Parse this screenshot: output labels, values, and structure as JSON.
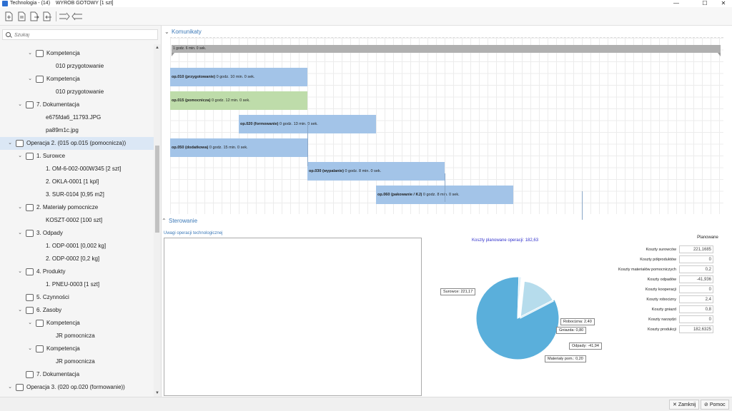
{
  "window": {
    "app_name": "Technologia - (14)",
    "doc_title": "WYRÓB GOTOWY [1 szt]",
    "minimize": "—",
    "maximize": "☐",
    "close": "✕"
  },
  "search": {
    "placeholder": "Szukaj"
  },
  "tree": [
    {
      "depth": 2,
      "chev": "⌄",
      "icon": "competence-icon",
      "label": "Kompetencja"
    },
    {
      "depth": 4,
      "chev": "",
      "icon": "",
      "label": "010 przygotowanie"
    },
    {
      "depth": 2,
      "chev": "⌄",
      "icon": "tool-icon",
      "label": "Kompetencja"
    },
    {
      "depth": 4,
      "chev": "",
      "icon": "",
      "label": "010 przygotowanie"
    },
    {
      "depth": 1,
      "chev": "⌄",
      "icon": "documents-icon",
      "label": "7. Dokumentacja"
    },
    {
      "depth": 3,
      "chev": "",
      "icon": "",
      "label": "e675fda6_11793.JPG"
    },
    {
      "depth": 3,
      "chev": "",
      "icon": "",
      "label": "pa89m1c.jpg"
    },
    {
      "depth": 0,
      "chev": "⌄",
      "icon": "operation-icon",
      "label": "Operacja 2. (015 op.015 (pomocnicza))",
      "selected": true
    },
    {
      "depth": 1,
      "chev": "⌄",
      "icon": "materials-icon",
      "label": "1. Surowce"
    },
    {
      "depth": 3,
      "chev": "",
      "icon": "",
      "label": "1. OM-6-002-000W345 [2 szt]"
    },
    {
      "depth": 3,
      "chev": "",
      "icon": "",
      "label": "2. OKLA-0001 [1 kpl]"
    },
    {
      "depth": 3,
      "chev": "",
      "icon": "",
      "label": "3. SUR-0104 [0,95 m2]"
    },
    {
      "depth": 1,
      "chev": "⌄",
      "icon": "aux-materials-icon",
      "label": "2. Materiały pomocnicze"
    },
    {
      "depth": 3,
      "chev": "",
      "icon": "",
      "label": "KOSZT-0002 [100 szt]"
    },
    {
      "depth": 1,
      "chev": "⌄",
      "icon": "waste-icon",
      "label": "3. Odpady"
    },
    {
      "depth": 3,
      "chev": "",
      "icon": "",
      "label": "1. ODP-0001 [0,002 kg]"
    },
    {
      "depth": 3,
      "chev": "",
      "icon": "",
      "label": "2. ODP-0002 [0,2 kg]"
    },
    {
      "depth": 1,
      "chev": "⌄",
      "icon": "products-icon",
      "label": "4. Produkty"
    },
    {
      "depth": 3,
      "chev": "",
      "icon": "",
      "label": "1. PNEU-0003 [1 szt]"
    },
    {
      "depth": 1,
      "chev": "",
      "icon": "activities-icon",
      "label": "5. Czynności"
    },
    {
      "depth": 1,
      "chev": "⌄",
      "icon": "resources-icon",
      "label": "6. Zasoby"
    },
    {
      "depth": 2,
      "chev": "⌄",
      "icon": "competence-icon",
      "label": "Kompetencja"
    },
    {
      "depth": 4,
      "chev": "",
      "icon": "",
      "label": "JR pomocnicza"
    },
    {
      "depth": 2,
      "chev": "⌄",
      "icon": "competence-icon",
      "label": "Kompetencja"
    },
    {
      "depth": 4,
      "chev": "",
      "icon": "",
      "label": "JR pomocnicza"
    },
    {
      "depth": 1,
      "chev": "",
      "icon": "documents-icon",
      "label": "7. Dokumentacja"
    },
    {
      "depth": 0,
      "chev": "⌄",
      "icon": "operation-icon",
      "label": "Operacja 3. (020 op.020 (formowanie))"
    }
  ],
  "komunikaty": {
    "title": "Komunikaty",
    "summary": "1 godz. 6 min. 0 sek.",
    "operations": [
      {
        "name": "op.010 (przygotowanie)",
        "time": "0 godz. 10 min. 0 sek.",
        "color": "#a3c4e8",
        "start": 0,
        "minutes": 10,
        "row": 0
      },
      {
        "name": "op.015 (pomocnicza)",
        "time": "0 godz. 12 min. 0 sek.",
        "color": "#bedcaa",
        "start": 0,
        "minutes": 12,
        "row": 1
      },
      {
        "name": "op.020 (formowanie)",
        "time": "0 godz. 13 min. 0 sek.",
        "color": "#a3c4e8",
        "start": 12,
        "minutes": 13,
        "row": 2
      },
      {
        "name": "op.050 (dodatkowa)",
        "time": "0 godz. 15 min. 0 sek.",
        "color": "#a3c4e8",
        "start": 0,
        "minutes": 15,
        "row": 3
      },
      {
        "name": "op.030 (wypalanie)",
        "time": "0 godz. 8 min. 0 sek.",
        "color": "#a3c4e8",
        "start": 24,
        "minutes": 8,
        "row": 4
      },
      {
        "name": "op.060 (pakowanie / KJ)",
        "time": "0 godz. 8 min. 0 sek.",
        "color": "#a3c4e8",
        "start": 36,
        "minutes": 8,
        "row": 5
      }
    ]
  },
  "sterowanie": {
    "title": "Sterowanie",
    "notes_label": "Uwagi operacji technologicznej",
    "notes_text": ""
  },
  "chart_data": {
    "type": "pie",
    "title": "Koszty planowane operacji: 182,63",
    "slices": [
      {
        "label": "Surowce: 221,17",
        "value": 221.17,
        "color": "#5aafdb"
      },
      {
        "label": "Robocizna: 2,40",
        "value": 2.4,
        "color": "#d8eef8"
      },
      {
        "label": "Gniazda: 0,80",
        "value": 0.8,
        "color": "#c8e6f2"
      },
      {
        "label": "Odpady: -41,94",
        "value": -41.94,
        "color": "#b6dcec"
      },
      {
        "label": "Materiały pom.: 0,20",
        "value": 0.2,
        "color": "#e8f4fa"
      }
    ]
  },
  "costs": {
    "column_header": "Planowane",
    "rows": [
      {
        "label": "Koszty surowców",
        "value": "221,1685"
      },
      {
        "label": "Koszty półproduktów",
        "value": "0"
      },
      {
        "label": "Koszty materiałów pomocniczych",
        "value": "0,2"
      },
      {
        "label": "Koszty odpadów",
        "value": "-41,936"
      },
      {
        "label": "Koszty kooperacji",
        "value": "0"
      },
      {
        "label": "Koszty robocizny",
        "value": "2,4"
      },
      {
        "label": "Koszty gniazd",
        "value": "0,8"
      },
      {
        "label": "Koszty narzędzi",
        "value": "0"
      },
      {
        "label": "Koszty produkcji",
        "value": "182,6325"
      }
    ]
  },
  "buttons": {
    "close": "Zamknij",
    "help": "Pomoc"
  }
}
